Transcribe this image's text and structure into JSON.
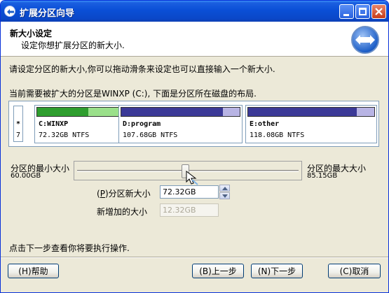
{
  "window": {
    "title": "扩展分区向导"
  },
  "header": {
    "title": "新大小设定",
    "subtitle": "设定你想扩展分区的新大小."
  },
  "intro": "请设定分区的新大小,你可以拖动滑条来设定也可以直接输入一个新大小.",
  "layout_caption": "当前需要被扩大的分区是WINXP (C:), 下面是分区所在磁盘的布局.",
  "disk": {
    "marker": "*",
    "number": "7",
    "partitions": [
      {
        "name": "C:WINXP",
        "info": "72.32GB NTFS",
        "used_fraction": 0.63,
        "bar_color": "#9ae08a",
        "used_color": "#2e9e2e"
      },
      {
        "name": "D:program",
        "info": "107.68GB NTFS",
        "used_fraction": 0.86,
        "bar_color": "#b8b4e4",
        "used_color": "#3b3997"
      },
      {
        "name": "E:other",
        "info": "118.08GB NTFS",
        "used_fraction": 0.86,
        "bar_color": "#b8b4e4",
        "used_color": "#3b3997"
      }
    ]
  },
  "slider": {
    "min_label": "分区的最小大小",
    "min_value": "60.00GB",
    "max_label": "分区的最大大小",
    "max_value": "85.15GB",
    "current_fraction": 0.49
  },
  "new_size": {
    "label_prefix": "(",
    "label_key": "P",
    "label_suffix": ")分区新大小",
    "value": "72.32GB"
  },
  "added_size": {
    "label": "新增加的大小",
    "value": "12.32GB"
  },
  "footer_text": "点击下一步查看你将要执行操作.",
  "buttons": {
    "help": "(H)帮助",
    "back": "(B)上一步",
    "next": "(N)下一步",
    "cancel": "(C)取消"
  }
}
